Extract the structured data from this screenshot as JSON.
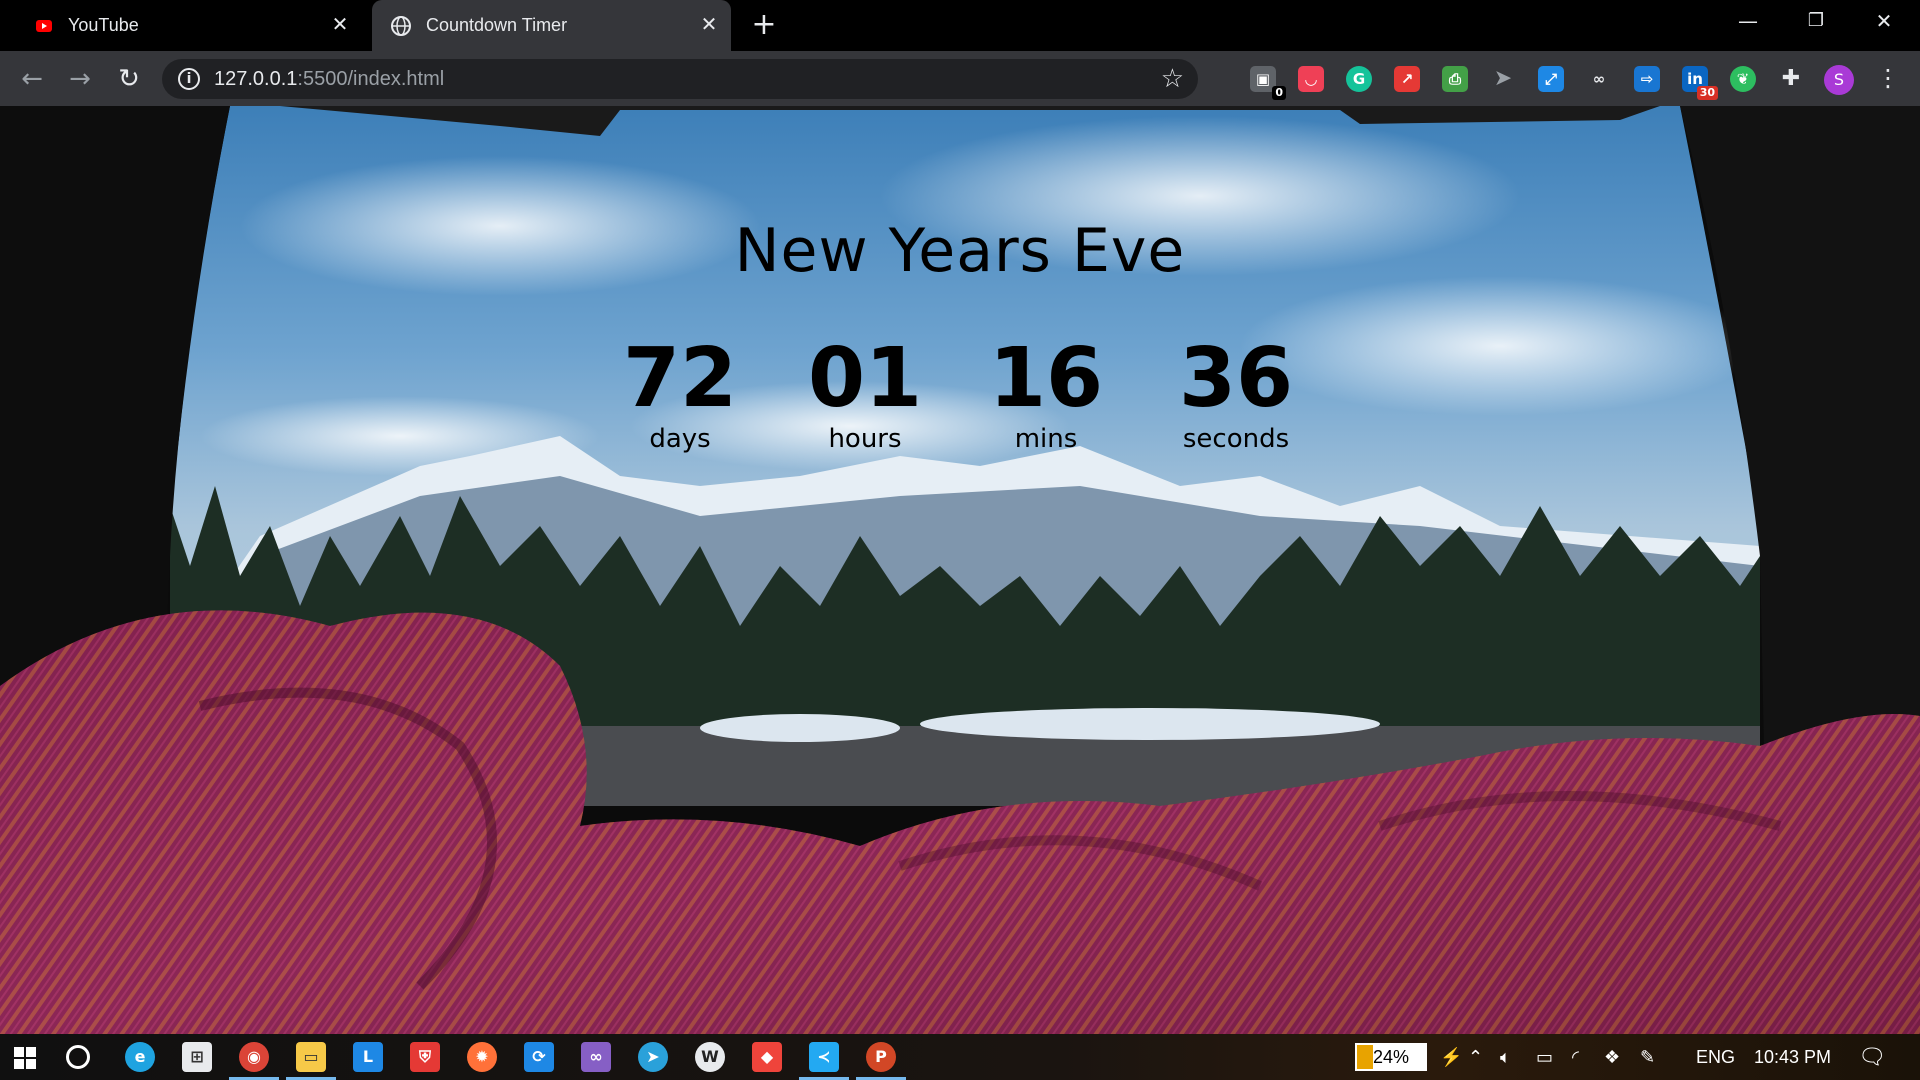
{
  "tabs": [
    {
      "title": "YouTube",
      "icon": "youtube-icon",
      "active": false
    },
    {
      "title": "Countdown Timer",
      "icon": "globe-icon",
      "active": true
    }
  ],
  "window_controls": {
    "minimize": "—",
    "restore": "❐",
    "close": "✕"
  },
  "address_bar": {
    "url_host": "127.0.0.1",
    "url_rest": ":5500/index.html"
  },
  "extensions": [
    {
      "icon": "toolbox-extension-icon",
      "badge": "0",
      "color": "#5f6368"
    },
    {
      "icon": "pocket-extension-icon",
      "color": "#ef4056"
    },
    {
      "icon": "grammarly-extension-icon",
      "color": "#15c39a"
    },
    {
      "icon": "arrow-extension-icon",
      "color": "#e53935"
    },
    {
      "icon": "print-extension-icon",
      "color": "#43a047"
    },
    {
      "icon": "bird-extension-icon",
      "color": "#9aa0a6"
    },
    {
      "icon": "resize-extension-icon",
      "color": "#1e88e5"
    },
    {
      "icon": "glasses-extension-icon",
      "color": "#e8eaed"
    },
    {
      "icon": "share-extension-icon",
      "color": "#1976d2"
    },
    {
      "icon": "linkedin-extension-icon",
      "badge": "30",
      "color": "#0a66c2"
    },
    {
      "icon": "evernote-extension-icon",
      "color": "#2dbe60"
    },
    {
      "icon": "puzzle-extensions-icon",
      "color": "#e8eaed"
    }
  ],
  "profile": {
    "initial": "S",
    "color": "#a93ad6"
  },
  "page": {
    "headline": "New Years Eve",
    "countdown": [
      {
        "value": "72",
        "label": "days"
      },
      {
        "value": "01",
        "label": "hours"
      },
      {
        "value": "16",
        "label": "mins"
      },
      {
        "value": "36",
        "label": "seconds"
      }
    ]
  },
  "taskbar": {
    "apps": [
      {
        "icon": "windows-start-icon"
      },
      {
        "icon": "cortana-circle-icon"
      },
      {
        "icon": "edge-icon",
        "color": "#1fa3e0"
      },
      {
        "icon": "store-icon",
        "color": "#e8eaed"
      },
      {
        "icon": "chrome-icon",
        "color": "#db4437",
        "active": true
      },
      {
        "icon": "file-explorer-icon",
        "color": "#f7c948",
        "active": true
      },
      {
        "icon": "l-app-icon",
        "label": "L",
        "color": "#1e88e5"
      },
      {
        "icon": "shield-app-icon",
        "color": "#e53935"
      },
      {
        "icon": "firefox-icon",
        "color": "#ff7139"
      },
      {
        "icon": "sync-app-icon",
        "color": "#1e88e5"
      },
      {
        "icon": "visual-studio-icon",
        "color": "#865fc5"
      },
      {
        "icon": "telegram-icon",
        "color": "#2aa1da"
      },
      {
        "icon": "w-app-icon",
        "color": "#e8eaed"
      },
      {
        "icon": "anydesk-icon",
        "color": "#ef443b"
      },
      {
        "icon": "vscode-icon",
        "color": "#23a9f2",
        "active": true
      },
      {
        "icon": "powerpoint-icon",
        "color": "#d24726",
        "active": true
      }
    ],
    "battery_percent": "24%",
    "battery_level": 0.24,
    "language": "ENG",
    "time": "10:43 PM"
  }
}
